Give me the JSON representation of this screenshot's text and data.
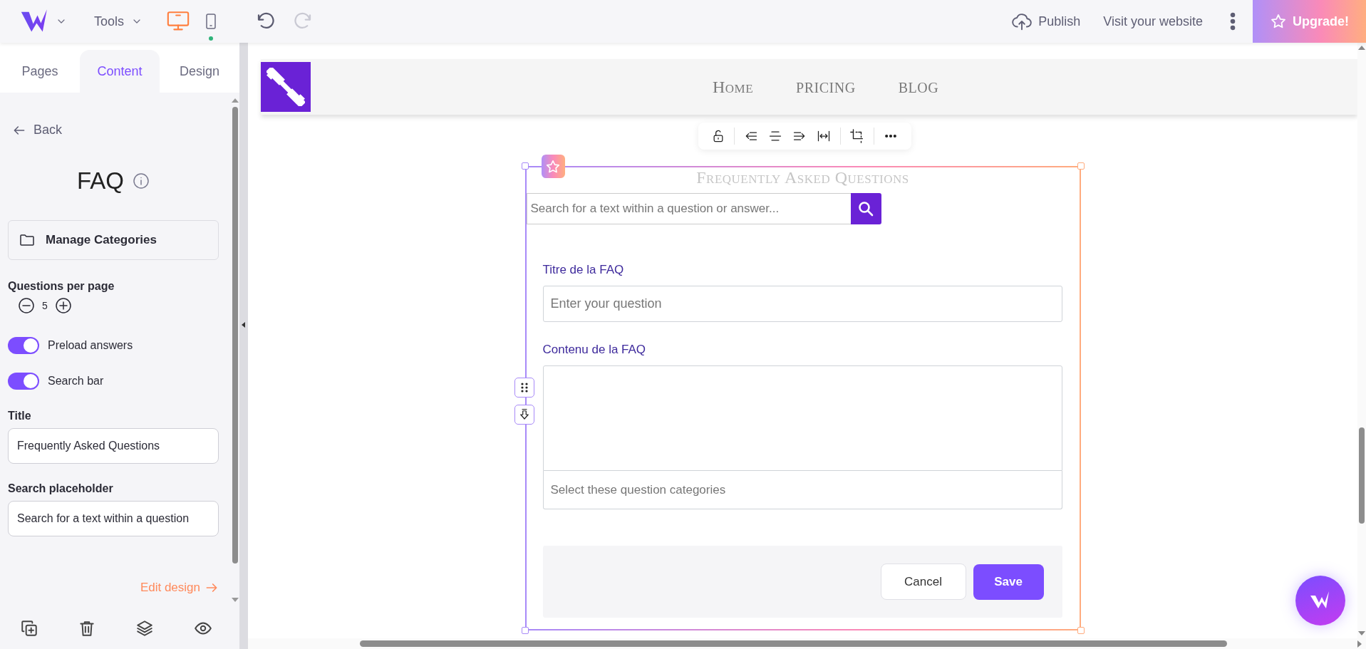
{
  "topbar": {
    "tools_menu": "Tools",
    "devices": [
      {
        "kind": "desktop",
        "selected": true
      },
      {
        "kind": "mobile",
        "selected": false
      }
    ],
    "history": [
      {
        "kind": "undo",
        "disabled": false
      },
      {
        "kind": "redo",
        "disabled": true
      }
    ],
    "publish": "Publish",
    "visit_website": "Visit your website",
    "upgrade": "Upgrade!"
  },
  "sidebar": {
    "tabs": [
      {
        "label": "Pages",
        "selected": false
      },
      {
        "label": "Content",
        "selected": true
      },
      {
        "label": "Design",
        "selected": false
      }
    ],
    "back": "Back",
    "heading": "FAQ",
    "manage_categories": "Manage Categories",
    "questions_per_page": {
      "label": "Questions per page",
      "value": "5"
    },
    "toggles": [
      {
        "label": "Preload answers",
        "on": true
      },
      {
        "label": "Search bar",
        "on": true
      }
    ],
    "fields": [
      {
        "label": "Title",
        "value": "Frequently Asked Questions"
      },
      {
        "label": "Search placeholder",
        "value": "Search for a text within a question"
      }
    ],
    "edit_design": "Edit design"
  },
  "site": {
    "nav": [
      {
        "label": "Home",
        "kind": "smallcaps"
      },
      {
        "label": "PRICING",
        "kind": "plain"
      },
      {
        "label": "BLOG",
        "kind": "plain"
      }
    ]
  },
  "faq": {
    "title": "Frequently Asked Questions",
    "search_placeholder": "Search for a text within a question or answer...",
    "form": {
      "question_label": "Titre de la FAQ",
      "question_placeholder": "Enter your question",
      "content_label": "Contenu de la FAQ",
      "categories_placeholder": "Select these question categories",
      "cancel": "Cancel",
      "save": "Save"
    }
  }
}
